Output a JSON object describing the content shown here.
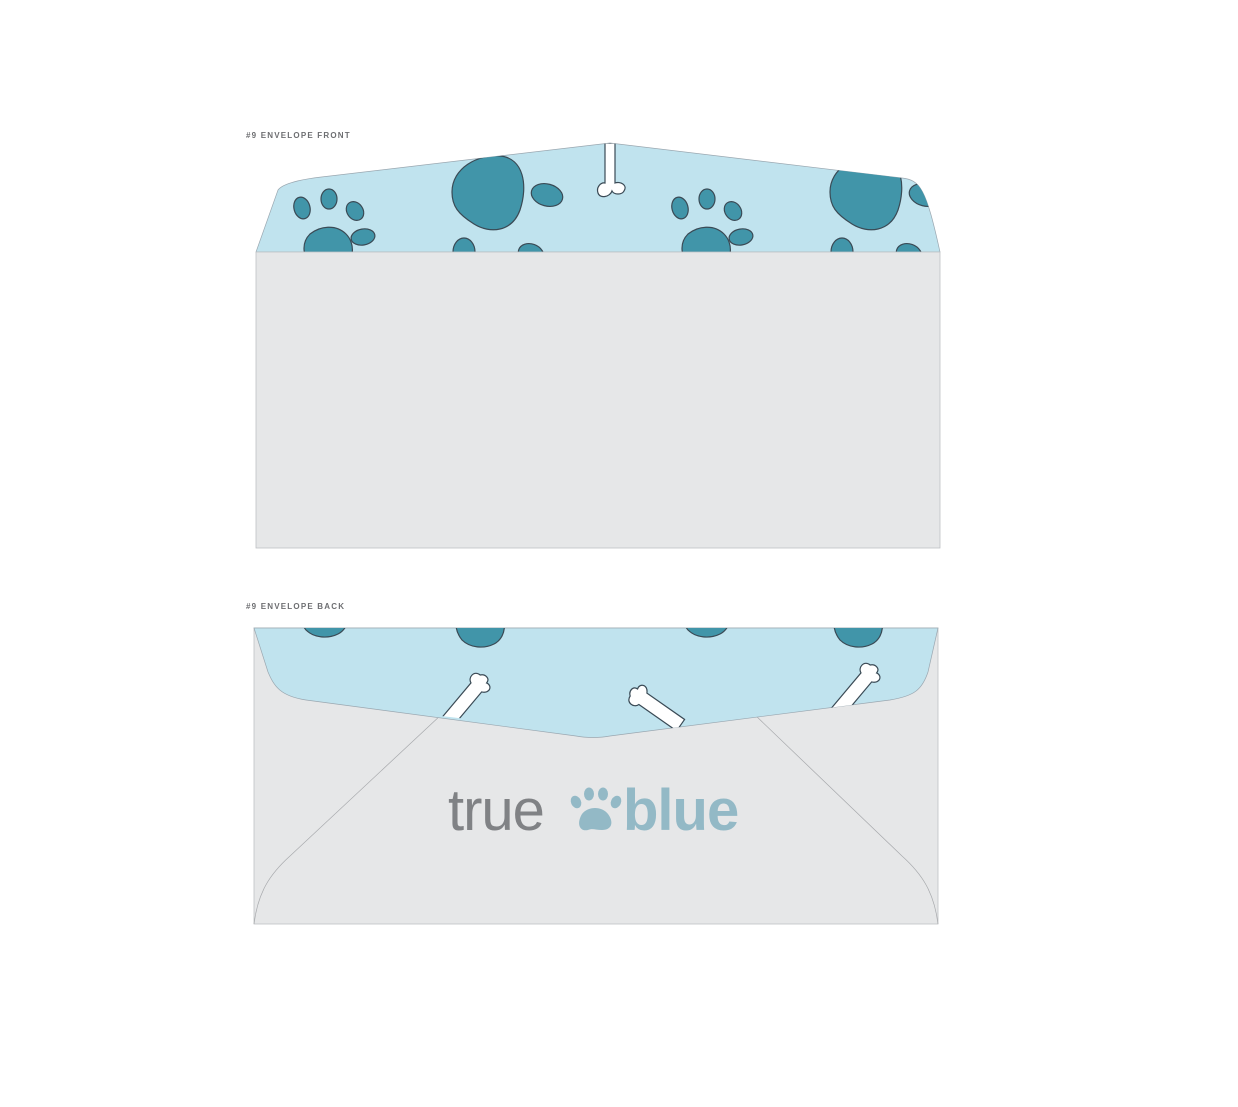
{
  "front": {
    "caption": "#9 ENVELOPE FRONT"
  },
  "back": {
    "caption": "#9 ENVELOPE BACK",
    "logo": {
      "word1": "true",
      "word2": "blue"
    }
  },
  "colors": {
    "envelope": "#e6e7e8",
    "liner": "#c0e3ee",
    "paw": "#4195a9",
    "outline": "#3a4a55",
    "bone": "#ffffff",
    "logo_true": "#808285",
    "logo_blue": "#93b9c6",
    "caption": "#6d6e71"
  },
  "icons": [
    "paw-print-icon",
    "dog-bone-icon",
    "paw-logo-icon"
  ]
}
